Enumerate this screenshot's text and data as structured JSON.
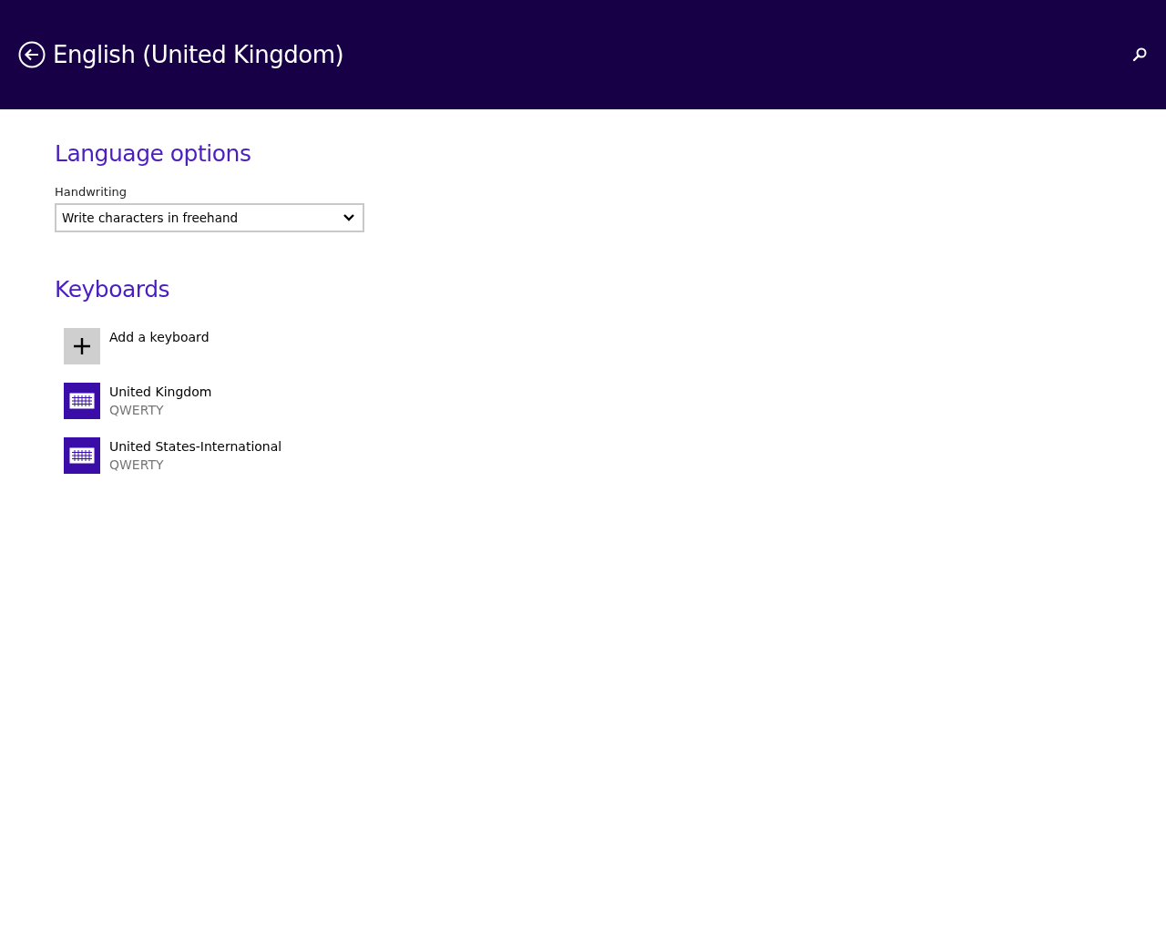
{
  "header": {
    "title": "English (United Kingdom)"
  },
  "language_options": {
    "heading": "Language options",
    "handwriting": {
      "label": "Handwriting",
      "value": "Write characters in freehand"
    }
  },
  "keyboards": {
    "heading": "Keyboards",
    "items": [
      {
        "kind": "add",
        "name": "Add a keyboard"
      },
      {
        "kind": "keyboard",
        "name": "United Kingdom",
        "layout": "QWERTY"
      },
      {
        "kind": "keyboard",
        "name": "United States-International",
        "layout": "QWERTY"
      }
    ]
  }
}
